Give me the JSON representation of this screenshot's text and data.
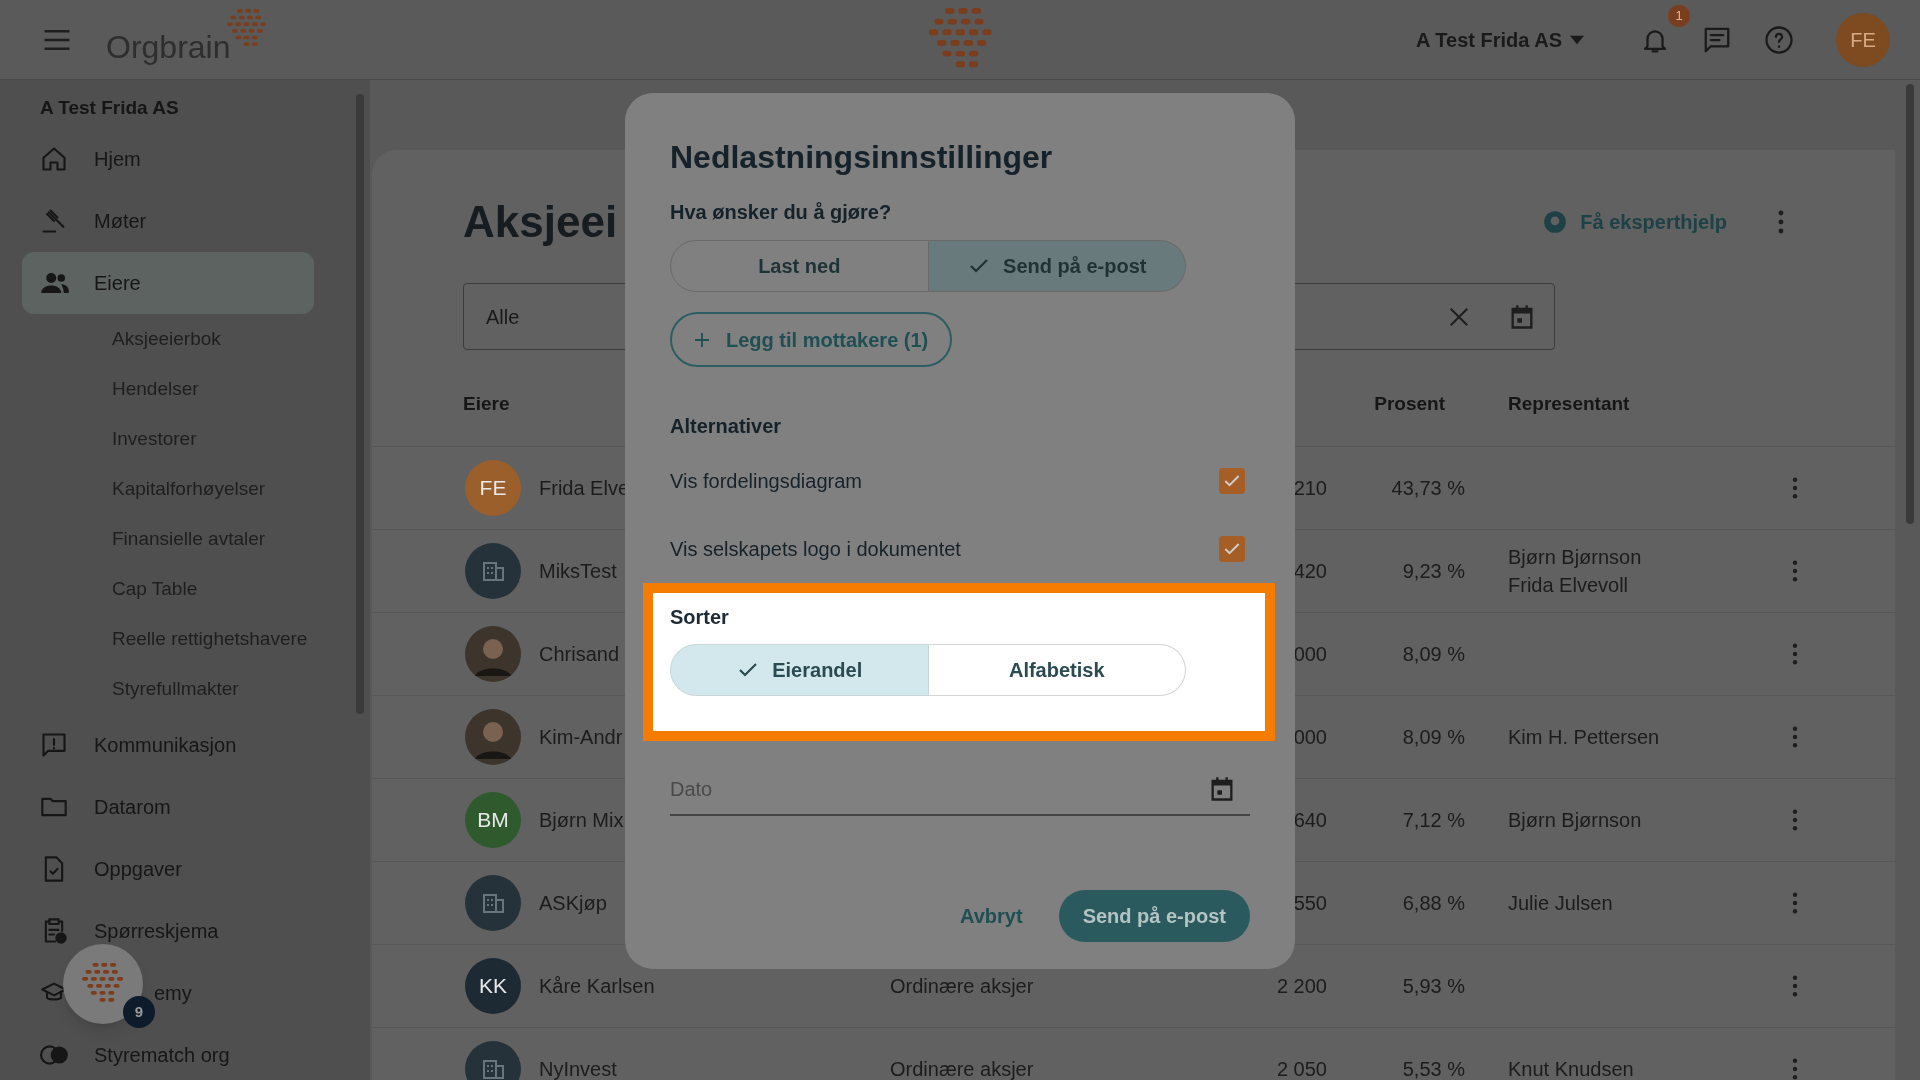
{
  "top_bar": {
    "logo_text": "Orgbrain",
    "company": "A Test Frida AS",
    "notification_count": "1",
    "avatar_initials": "FE"
  },
  "sidebar": {
    "company": "A Test Frida AS",
    "items": [
      {
        "label": "Hjem",
        "selected": false
      },
      {
        "label": "Møter",
        "selected": false
      },
      {
        "label": "Eiere",
        "selected": true,
        "children": [
          {
            "label": "Aksjeeierbok"
          },
          {
            "label": "Hendelser"
          },
          {
            "label": "Investorer"
          },
          {
            "label": "Kapitalforhøyelser"
          },
          {
            "label": "Finansielle avtaler"
          },
          {
            "label": "Cap Table"
          },
          {
            "label": "Reelle rettighetshavere"
          },
          {
            "label": "Styrefullmakter"
          }
        ]
      },
      {
        "label": "Kommunikasjon",
        "selected": false
      },
      {
        "label": "Datarom",
        "selected": false
      },
      {
        "label": "Oppgaver",
        "selected": false
      },
      {
        "label": "Spørreskjema",
        "selected": false
      },
      {
        "label": "emy",
        "selected": false
      },
      {
        "label": "Styrematch org",
        "selected": false
      }
    ]
  },
  "help_button": {
    "badge": "9"
  },
  "main": {
    "title": "Aksjeei",
    "filter_value": "Alle",
    "help_link": "Få eksperthjelp",
    "columns": {
      "owner": "Eiere",
      "percent": "Prosent",
      "representative": "Representant"
    },
    "rows": [
      {
        "kind": "initials",
        "initials": "FE",
        "color": "#9a5f2a",
        "name": "Frida Elve",
        "shares": "210",
        "percent": "43,73 %",
        "representatives": []
      },
      {
        "kind": "building",
        "name": "MiksTest",
        "shares": "420",
        "percent": "9,23 %",
        "representatives": [
          "Bjørn Bjørnson",
          "Frida Elvevoll"
        ]
      },
      {
        "kind": "photo",
        "name": "Chrisand",
        "shares": "000",
        "percent": "8,09 %",
        "representatives": []
      },
      {
        "kind": "photo",
        "name": "Kim-Andr",
        "shares": "000",
        "percent": "8,09 %",
        "representatives": [
          "Kim H. Pettersen"
        ]
      },
      {
        "kind": "initials",
        "initials": "BM",
        "color": "#2f5a2d",
        "name": "Bjørn Mix",
        "shares": "640",
        "percent": "7,12 %",
        "representatives": [
          "Bjørn Bjørnson"
        ]
      },
      {
        "kind": "building",
        "name": "ASKjøp",
        "shares": "550",
        "percent": "6,88 %",
        "representatives": [
          "Julie Julsen"
        ]
      },
      {
        "kind": "initials",
        "initials": "KK",
        "color": "#1e2a33",
        "name": "Kåre Karlsen",
        "share_class": "Ordinære aksjer",
        "shares": "2 200",
        "percent": "5,93 %",
        "representatives": []
      },
      {
        "kind": "building",
        "name": "NyInvest",
        "share_class": "Ordinære aksjer",
        "shares": "2 050",
        "percent": "5,53 %",
        "representatives": [
          "Knut Knudsen"
        ]
      }
    ]
  },
  "dialog": {
    "title": "Nedlastningsinnstillinger",
    "question": "Hva ønsker du å gjøre?",
    "actions": [
      {
        "label": "Last ned",
        "selected": false
      },
      {
        "label": "Send på e-post",
        "selected": true
      }
    ],
    "add_recipients": "Legg til mottakere (1)",
    "alternatives_heading": "Alternativer",
    "alternatives": [
      {
        "label": "Vis fordelingsdiagram",
        "checked": true
      },
      {
        "label": "Vis selskapets logo i dokumentet",
        "checked": true
      }
    ],
    "sort_heading": "Sorter",
    "sort_options": [
      {
        "label": "Eierandel",
        "selected": true
      },
      {
        "label": "Alfabetisk",
        "selected": false
      }
    ],
    "date_field": {
      "placeholder": "Dato"
    },
    "cancel": "Avbryt",
    "submit": "Send på e-post"
  }
}
